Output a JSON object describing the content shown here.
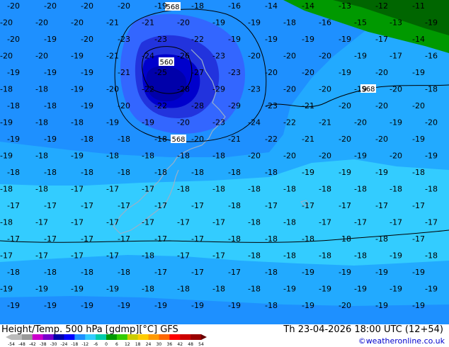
{
  "map": {
    "contour_labels": [
      {
        "value": "568"
      },
      {
        "value": "560"
      },
      {
        "value": "568"
      },
      {
        "value": "568"
      }
    ],
    "temperature_values": [
      "-20",
      "-20",
      "-20",
      "-20",
      "-19",
      "-18",
      "-16",
      "-14",
      "-14",
      "-13",
      "-12",
      "-11",
      "-20",
      "-20",
      "-20",
      "-21",
      "-21",
      "-20",
      "-19",
      "-19",
      "-18",
      "-16",
      "-15",
      "-13",
      "-19",
      "-20",
      "-19",
      "-20",
      "-23",
      "-23",
      "-22",
      "-19",
      "-19",
      "-19",
      "-19",
      "-17",
      "-14",
      "-20",
      "-20",
      "-19",
      "-21",
      "-24",
      "-26",
      "-23",
      "-20",
      "-20",
      "-20",
      "-19",
      "-17",
      "-16",
      "-19",
      "-19",
      "-19",
      "-21",
      "-25",
      "-27",
      "-23",
      "-20",
      "-20",
      "-19",
      "-20",
      "-19",
      "-18",
      "-18",
      "-19",
      "-20",
      "-22",
      "-28",
      "-29",
      "-23",
      "-20",
      "-20",
      "-19",
      "-20",
      "-18",
      "-18",
      "-18",
      "-19",
      "-20",
      "-22",
      "-28",
      "-29",
      "-23",
      "-21",
      "-20",
      "-20",
      "-20",
      "-19",
      "-18",
      "-18",
      "-19",
      "-19",
      "-20",
      "-23",
      "-24",
      "-22",
      "-21",
      "-20",
      "-19",
      "-20",
      "-19",
      "-19",
      "-18",
      "-18",
      "-18",
      "-20",
      "-21",
      "-22",
      "-21",
      "-20",
      "-20",
      "-19",
      "-19",
      "-18",
      "-19",
      "-18",
      "-18",
      "-18",
      "-18",
      "-20",
      "-20",
      "-20",
      "-19",
      "-20",
      "-19",
      "-18",
      "-18",
      "-18",
      "-18",
      "-18",
      "-18",
      "-18",
      "-18",
      "-19",
      "-19",
      "-19",
      "-18",
      "-18",
      "-18",
      "-17",
      "-17",
      "-17",
      "-18",
      "-18",
      "-18",
      "-18",
      "-18",
      "-18",
      "-18",
      "-18",
      "-17",
      "-17",
      "-17",
      "-17",
      "-17",
      "-17",
      "-18",
      "-17",
      "-17",
      "-17",
      "-17",
      "-17",
      "-18",
      "-17",
      "-17",
      "-17",
      "-17",
      "-17",
      "-17",
      "-18",
      "-18",
      "-17",
      "-17",
      "-17",
      "-17",
      "-17",
      "-17",
      "-17",
      "-17",
      "-17",
      "-17",
      "-18",
      "-18",
      "-18",
      "-18",
      "-18",
      "-17",
      "-17",
      "-17",
      "-17",
      "-17",
      "-18",
      "-17",
      "-17",
      "-18",
      "-18",
      "-18",
      "-18",
      "-19",
      "-18",
      "-18",
      "-18",
      "-18",
      "-18",
      "-17",
      "-17",
      "-17",
      "-18",
      "-19",
      "-19",
      "-19",
      "-19",
      "-19",
      "-19",
      "-19",
      "-19",
      "-18",
      "-18",
      "-18",
      "-18",
      "-19",
      "-19",
      "-19",
      "-19",
      "-19",
      "-19",
      "-19",
      "-19",
      "-19",
      "-19",
      "-19",
      "-19",
      "-18",
      "-19",
      "-20",
      "-19",
      "-19",
      "-19",
      "-19",
      "-19",
      "-19",
      "-20",
      "-20",
      "-19",
      "-19"
    ],
    "colors": {
      "ocean_light": "#33ccff",
      "band_minus18": "#22aaff",
      "band_minus20": "#1e90ff",
      "band_minus22": "#3366ff",
      "band_minus24": "#2233dd",
      "band_minus26": "#0000cc",
      "band_minus28": "#0000aa",
      "green_dark": "#006600",
      "green_light": "#009900"
    }
  },
  "footer": {
    "title": "Height/Temp. 500 hPa [gdmp][°C] GFS",
    "valid": "Th 23-04-2026 18:00 UTC (12+54)",
    "credit": "©weatheronline.co.uk",
    "colorbar_ticks": [
      "-54",
      "-48",
      "-42",
      "-38",
      "-30",
      "-24",
      "-18",
      "-12",
      "-6",
      "0",
      "6",
      "12",
      "18",
      "24",
      "30",
      "36",
      "42",
      "48",
      "54"
    ],
    "colorbar_colors": [
      "#bbbbbb",
      "#999999",
      "#cc00cc",
      "#7700cc",
      "#0000aa",
      "#0000ff",
      "#1e90ff",
      "#33ccff",
      "#00ccaa",
      "#009900",
      "#33cc00",
      "#cccc00",
      "#ffcc00",
      "#ff9900",
      "#ff6600",
      "#ff0000",
      "#cc0000",
      "#990000"
    ]
  }
}
